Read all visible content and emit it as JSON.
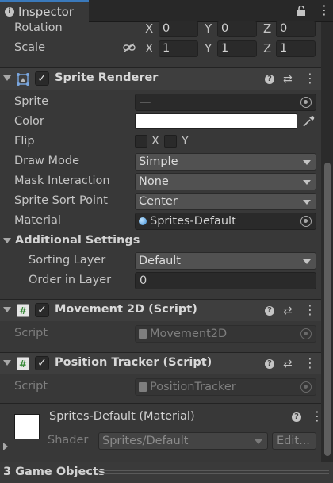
{
  "tab": {
    "title": "Inspector"
  },
  "transform": {
    "rotation": {
      "label": "Rotation",
      "x": "0",
      "y": "0",
      "z": "0"
    },
    "scale": {
      "label": "Scale",
      "x": "1",
      "y": "1",
      "z": "1"
    },
    "axes": {
      "x": "X",
      "y": "Y",
      "z": "Z"
    }
  },
  "sprite_renderer": {
    "title": "Sprite Renderer",
    "sprite": {
      "label": "Sprite",
      "value": "—"
    },
    "color": {
      "label": "Color",
      "value": "#ffffff"
    },
    "flip": {
      "label": "Flip",
      "x": "X",
      "y": "Y"
    },
    "draw_mode": {
      "label": "Draw Mode",
      "value": "Simple"
    },
    "mask_interaction": {
      "label": "Mask Interaction",
      "value": "None"
    },
    "sort_point": {
      "label": "Sprite Sort Point",
      "value": "Center"
    },
    "material": {
      "label": "Material",
      "value": "Sprites-Default"
    },
    "additional": {
      "label": "Additional Settings"
    },
    "sorting_layer": {
      "label": "Sorting Layer",
      "value": "Default"
    },
    "order_in_layer": {
      "label": "Order in Layer",
      "value": "0"
    }
  },
  "movement": {
    "title": "Movement 2D (Script)",
    "script_label": "Script",
    "script_value": "Movement2D"
  },
  "tracker": {
    "title": "Position Tracker (Script)",
    "script_label": "Script",
    "script_value": "PositionTracker"
  },
  "material_preview": {
    "title": "Sprites-Default (Material)",
    "shader_label": "Shader",
    "shader_value": "Sprites/Default",
    "edit_label": "Edit..."
  },
  "footer": {
    "label": "3 Game Objects"
  },
  "colors": {
    "accent": "#3a79bb",
    "panel": "#383838",
    "header": "#3e3e3e",
    "field": "#2a2a2a"
  }
}
